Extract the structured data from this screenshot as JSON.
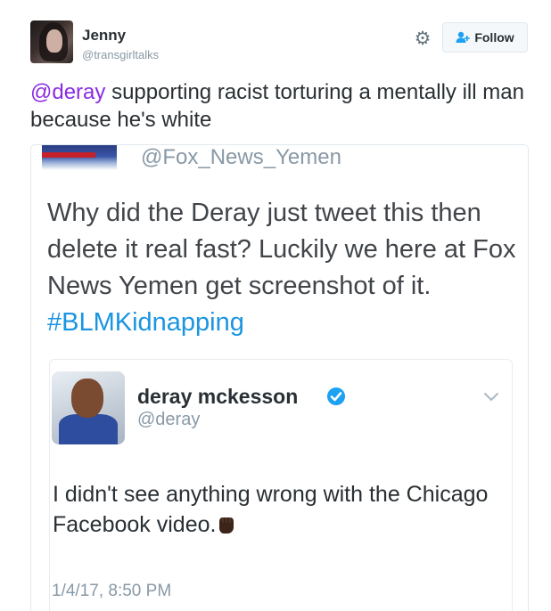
{
  "header": {
    "name": "Jenny",
    "handle": "@transgirltalks",
    "follow_label": "Follow"
  },
  "tweet": {
    "mention": "@deray",
    "text": " supporting racist torturing a mentally ill man because he's white"
  },
  "screenshot": {
    "handle": "@Fox_News_Yemen",
    "text": "Why did the Deray just tweet this then delete it real fast? Luckily we here at Fox News Yemen get screenshot of it. ",
    "hashtag": "#BLMKidnapping",
    "embedded": {
      "name": "deray mckesson",
      "handle": "@deray",
      "text": "I didn't see anything wrong with the Chicago Facebook video.",
      "timestamp": "1/4/17, 8:50 PM"
    }
  },
  "colors": {
    "mention": "#8a2be2",
    "hashtag": "#1b95e0",
    "verified": "#1da1f2",
    "muted": "#8899a6"
  },
  "icons": [
    "gear-icon",
    "follow-person-icon",
    "verified-badge-icon",
    "chevron-down-icon",
    "raised-fist-icon"
  ]
}
